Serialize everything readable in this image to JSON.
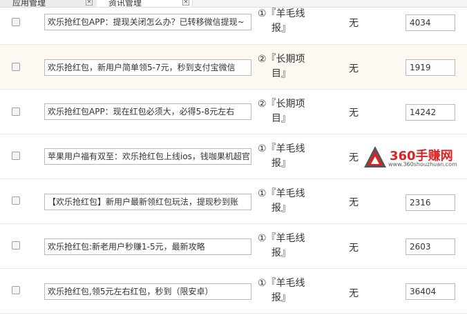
{
  "tabs": [
    {
      "label": "应用管理",
      "close": "×"
    },
    {
      "label": "资讯管理",
      "close": "×"
    }
  ],
  "rows": [
    {
      "title": "欢乐抢红包APP：提现关闭怎么办？已转移微信提现~",
      "cat_line1": "①『羊毛线",
      "cat_line2": "报』",
      "extra": "无",
      "views": "4034"
    },
    {
      "title": "欢乐抢红包，新用户简单领5-7元，秒到支付宝微信",
      "cat_line1": "②『长期项",
      "cat_line2": "目』",
      "extra": "无",
      "views": "1919"
    },
    {
      "title": "欢乐抢红包APP：现在红包必须大，必得5-8元左右",
      "cat_line1": "②『长期项",
      "cat_line2": "目』",
      "extra": "无",
      "views": "14242"
    },
    {
      "title": "苹果用户福有双至：欢乐抢红包上线ios，钱咖果机超官",
      "cat_line1": "①『羊毛线",
      "cat_line2": "报』",
      "extra": "无",
      "views": ""
    },
    {
      "title": "【欢乐抢红包】新用户最新领红包玩法，提现秒到账",
      "cat_line1": "①『羊毛线",
      "cat_line2": "报』",
      "extra": "无",
      "views": "2316"
    },
    {
      "title": "欢乐抢红包:新老用户秒赚1-5元，最新攻略",
      "cat_line1": "①『羊毛线",
      "cat_line2": "报』",
      "extra": "无",
      "views": "2603"
    },
    {
      "title": "欢乐抢红包,领5元左右红包，秒到（限安卓）",
      "cat_line1": "①『羊毛线",
      "cat_line2": "报』",
      "extra": "无",
      "views": "36404"
    }
  ],
  "watermark": {
    "brand": "360手赚网",
    "url": "www.360shouzhuan.com"
  },
  "colors": {
    "alt_row": "#fdf8f1",
    "brand_red": "#e02020"
  }
}
